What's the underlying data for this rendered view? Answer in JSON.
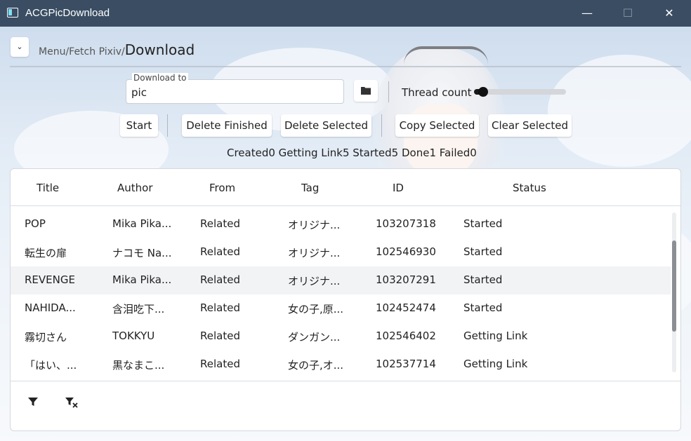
{
  "window": {
    "title": "ACGPicDownload"
  },
  "header": {
    "breadcrumb_path": "Menu/Fetch Pixiv/",
    "breadcrumb_current": "Download"
  },
  "download": {
    "label": "Download to",
    "value": "pic",
    "thread_label": "Thread count",
    "thread_level": 0.1
  },
  "actions": {
    "start": "Start",
    "delete_finished": "Delete Finished",
    "delete_selected": "Delete Selected",
    "copy_selected": "Copy Selected",
    "clear_selected": "Clear Selected"
  },
  "status_line": "Created0 Getting Link5 Started5 Done1 Failed0",
  "table": {
    "columns": [
      "Title",
      "Author",
      "From",
      "Tag",
      "ID",
      "Status"
    ],
    "rows": [
      {
        "title": "POP",
        "author": "Mika Pika...",
        "from": "Related",
        "tag": "オリジナ...",
        "id": "103207318",
        "status": "Started"
      },
      {
        "title": "転生の扉",
        "author": "ナコモ Na...",
        "from": "Related",
        "tag": "オリジナ...",
        "id": "102546930",
        "status": "Started"
      },
      {
        "title": "REVENGE",
        "author": "Mika Pika...",
        "from": "Related",
        "tag": "オリジナ...",
        "id": "103207291",
        "status": "Started"
      },
      {
        "title": "NAHIDA...",
        "author": "含泪吃下...",
        "from": "Related",
        "tag": "女の子,原...",
        "id": "102452474",
        "status": "Started"
      },
      {
        "title": "霧切さん",
        "author": "TOKKYU",
        "from": "Related",
        "tag": "ダンガン...",
        "id": "102546402",
        "status": "Getting Link"
      },
      {
        "title": "「はい、...",
        "author": "黒なまこ...",
        "from": "Related",
        "tag": "女の子,オ...",
        "id": "102537714",
        "status": "Getting Link"
      }
    ]
  },
  "footer": {
    "icons": [
      "filter-icon",
      "clear-filter-icon"
    ]
  }
}
